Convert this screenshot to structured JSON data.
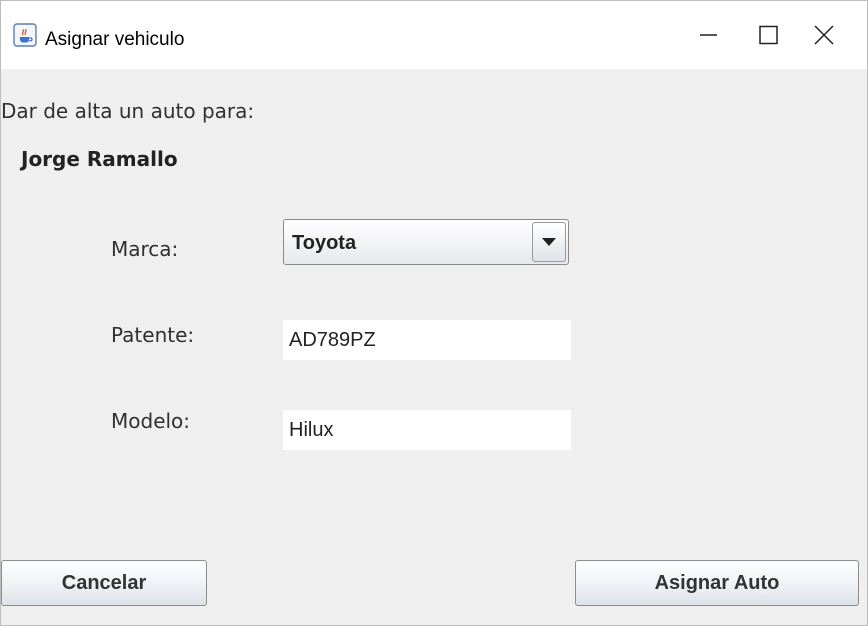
{
  "window": {
    "title": "Asignar vehiculo",
    "app_icon": "java-cup-icon",
    "controls": [
      "minimize-icon",
      "maximize-icon",
      "close-icon"
    ]
  },
  "form": {
    "intro": "Dar de alta un auto para:",
    "person_name": "Jorge Ramallo",
    "marca": {
      "label": "Marca:",
      "selected": "Toyota"
    },
    "patente": {
      "label": "Patente:",
      "value": "AD789PZ"
    },
    "modelo": {
      "label": "Modelo:",
      "value": "Hilux"
    }
  },
  "buttons": {
    "cancel_label": "Cancelar",
    "assign_label": "Asignar Auto"
  },
  "colors": {
    "background": "#efefef",
    "titlebar": "#ffffff",
    "button_border": "#8c8c8c"
  }
}
